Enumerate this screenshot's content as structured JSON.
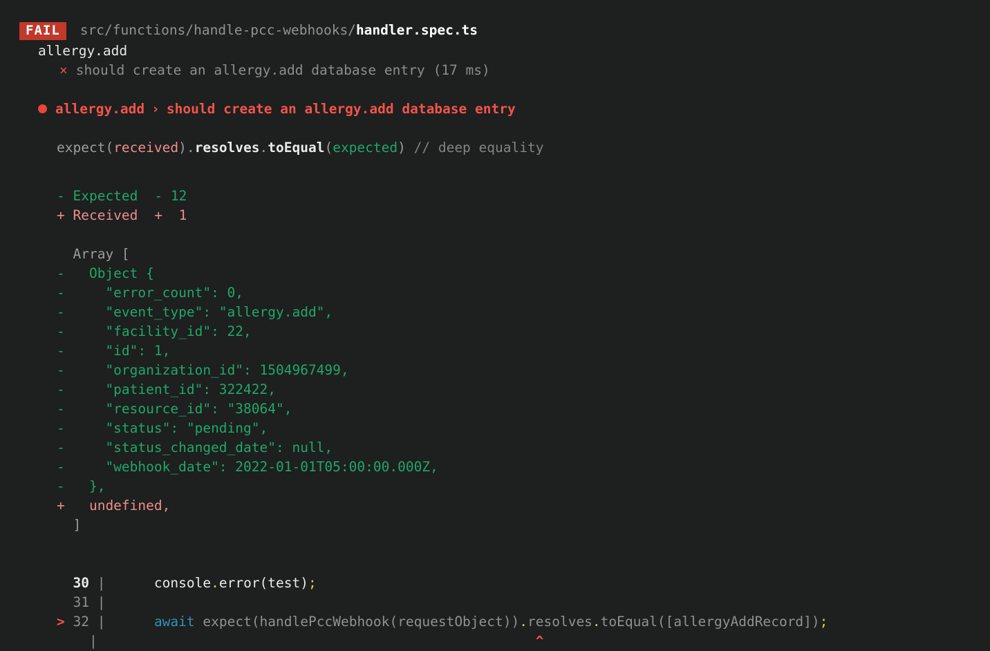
{
  "terminal": {
    "background": "#1e1f1f",
    "clipped_top_line": "    .                        .                 .              .",
    "colors": {
      "fail_badge_bg": "#c1392b",
      "expected_green": "#1fa86a",
      "received_red": "#ed8f8a",
      "title_red": "#f2544b",
      "dim_gray": "#9a9e9e",
      "bright_white": "#e9eaea",
      "punct_yellow": "#d7d14a",
      "keyword_cyan": "#2c94b5"
    }
  },
  "header": {
    "status_badge": "FAIL",
    "path_prefix": "src/functions/handle-pcc-webhooks/",
    "path_file": "handler.spec.ts",
    "suite_name": "allergy.add",
    "test_marker": "×",
    "test_name": "should create an allergy.add database entry",
    "test_duration": "(17 ms)"
  },
  "failure": {
    "bullet": "●",
    "suite": "allergy.add",
    "separator": "›",
    "test": "should create an allergy.add database entry",
    "matcher_hint": {
      "expect_open": "expect(",
      "received_word": "received",
      "expect_close": ").",
      "chain": "resolves",
      "dot": ".",
      "matcher": "toEqual",
      "paren_open": "(",
      "expected_word": "expected",
      "paren_close": ")",
      "comment": " // deep equality"
    },
    "legend": {
      "expected_label": "- Expected",
      "expected_count": "- 12",
      "received_label": "+ Received",
      "received_count": "+  1"
    },
    "diff_lines": [
      {
        "kind": "context",
        "sign": "  ",
        "text": "Array ["
      },
      {
        "kind": "expected",
        "sign": "- ",
        "text": "  Object {"
      },
      {
        "kind": "expected",
        "sign": "- ",
        "text": "    \"error_count\": 0,"
      },
      {
        "kind": "expected",
        "sign": "- ",
        "text": "    \"event_type\": \"allergy.add\","
      },
      {
        "kind": "expected",
        "sign": "- ",
        "text": "    \"facility_id\": 22,"
      },
      {
        "kind": "expected",
        "sign": "- ",
        "text": "    \"id\": 1,"
      },
      {
        "kind": "expected",
        "sign": "- ",
        "text": "    \"organization_id\": 1504967499,"
      },
      {
        "kind": "expected",
        "sign": "- ",
        "text": "    \"patient_id\": 322422,"
      },
      {
        "kind": "expected",
        "sign": "- ",
        "text": "    \"resource_id\": \"38064\","
      },
      {
        "kind": "expected",
        "sign": "- ",
        "text": "    \"status\": \"pending\","
      },
      {
        "kind": "expected",
        "sign": "- ",
        "text": "    \"status_changed_date\": null,"
      },
      {
        "kind": "expected",
        "sign": "- ",
        "text": "    \"webhook_date\": 2022-01-01T05:00:00.000Z,"
      },
      {
        "kind": "expected",
        "sign": "- ",
        "text": "  },"
      },
      {
        "kind": "received",
        "sign": "+ ",
        "text": "  undefined,"
      },
      {
        "kind": "context",
        "sign": "  ",
        "text": "]"
      }
    ]
  },
  "code_frame": {
    "lines": [
      {
        "marker": " ",
        "number": "30",
        "pipe": "|",
        "bright": true,
        "segments": [
          {
            "style": "bright",
            "text": "      console"
          },
          {
            "style": "punct",
            "text": "."
          },
          {
            "style": "bright",
            "text": "error(test)"
          },
          {
            "style": "punct",
            "text": ";"
          }
        ]
      },
      {
        "marker": " ",
        "number": "31",
        "pipe": "|",
        "bright": false,
        "segments": []
      },
      {
        "marker": ">",
        "number": "32",
        "pipe": "|",
        "bright": false,
        "segments": [
          {
            "style": "dim",
            "text": "      "
          },
          {
            "style": "await",
            "text": "await"
          },
          {
            "style": "dim",
            "text": " expect(handlePccWebhook(requestObject))"
          },
          {
            "style": "punct",
            "text": "."
          },
          {
            "style": "dim",
            "text": "resolves"
          },
          {
            "style": "punct",
            "text": "."
          },
          {
            "style": "dim",
            "text": "toEqual([allergyAddRecord])"
          },
          {
            "style": "punct",
            "text": ";"
          }
        ]
      }
    ],
    "caret_row": {
      "pipe": "|",
      "caret": "^",
      "caret_indent": 54
    }
  }
}
